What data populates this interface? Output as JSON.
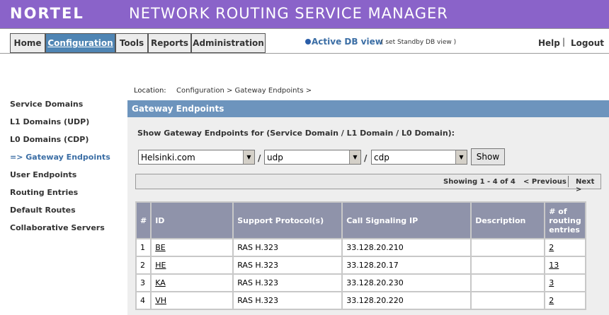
{
  "header": {
    "logo": "NORTEL",
    "app_title": "NETWORK ROUTING SERVICE MANAGER"
  },
  "nav": {
    "tabs": [
      {
        "label": "Home"
      },
      {
        "label": "Configuration",
        "active": true
      },
      {
        "label": "Tools"
      },
      {
        "label": "Reports"
      },
      {
        "label": "Administration"
      }
    ],
    "db_active": "Active DB view",
    "db_standby": "( set Standby DB view )",
    "help": "Help",
    "separator": "|",
    "logout": "Logout"
  },
  "sidebar": {
    "items": [
      {
        "label": "Service Domains"
      },
      {
        "label": "L1 Domains (UDP)"
      },
      {
        "label": "L0 Domains (CDP)"
      },
      {
        "label": "=> Gateway Endpoints",
        "current": true
      },
      {
        "label": "User Endpoints"
      },
      {
        "label": "Routing Entries"
      },
      {
        "label": "Default Routes"
      },
      {
        "label": "Collaborative Servers"
      }
    ]
  },
  "location": {
    "label": "Location:",
    "path": "Configuration > Gateway Endpoints >"
  },
  "section": {
    "title": "Gateway Endpoints",
    "show_label": "Show Gateway Endpoints for (Service Domain / L1 Domain / L0 Domain):"
  },
  "filters": {
    "service_domain": "Helsinki.com",
    "l1_domain": "udp",
    "l0_domain": "cdp",
    "separator": "/",
    "show_button": "Show"
  },
  "pager": {
    "showing": "Showing 1 - 4 of 4",
    "previous": "< Previous",
    "next": "Next >"
  },
  "table": {
    "columns": [
      "#",
      "ID",
      "Support Protocol(s)",
      "Call Signaling IP",
      "Description",
      "# of routing entries"
    ],
    "rows": [
      {
        "num": "1",
        "id": "BE",
        "protocol": "RAS H.323",
        "ip": "33.128.20.210",
        "description": "",
        "routing": "2"
      },
      {
        "num": "2",
        "id": "HE",
        "protocol": "RAS H.323",
        "ip": "33.128.20.17",
        "description": "",
        "routing": "13"
      },
      {
        "num": "3",
        "id": "KA",
        "protocol": "RAS H.323",
        "ip": "33.128.20.230",
        "description": "",
        "routing": "3"
      },
      {
        "num": "4",
        "id": "VH",
        "protocol": "RAS H.323",
        "ip": "33.128.20.220",
        "description": "",
        "routing": "2"
      }
    ]
  },
  "colors": {
    "banner": "#8a63c9",
    "active_tab": "#4f85b4",
    "section_bar": "#6d94bd",
    "table_header": "#8f93aa",
    "link_blue": "#3b6ea5"
  }
}
